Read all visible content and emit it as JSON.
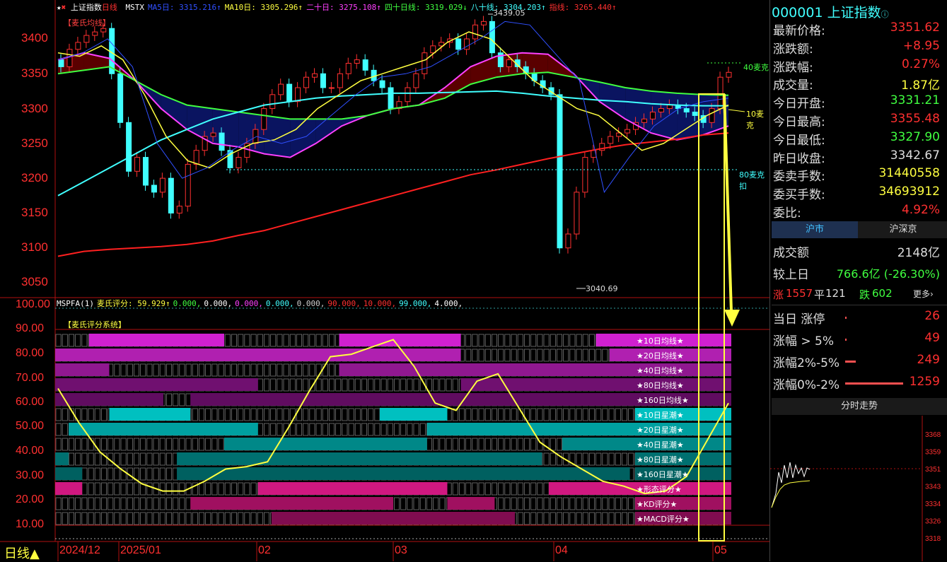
{
  "header": {
    "index_name": "上证指数",
    "period": "日线",
    "ma_items": [
      {
        "label": "MSTX",
        "color": "#ffffff"
      },
      {
        "label": "MA5日: 3315.216↑",
        "color": "#3050ff"
      },
      {
        "label": "MA10日: 3305.296↑",
        "color": "#ffff40"
      },
      {
        "label": "二十日: 3275.108↑",
        "color": "#ff40ff"
      },
      {
        "label": "四十日线: 3319.029↓",
        "color": "#40ff40"
      },
      {
        "label": "八十线: 3304.203↑",
        "color": "#40ffff"
      },
      {
        "label": "指线: 3265.440↑",
        "color": "#ff3030"
      }
    ],
    "price_high_mark": "3439.05",
    "price_low_mark": "3040.69"
  },
  "main_tag": "【麦氏均线】",
  "right_labels": {
    "ma40": "40麦克",
    "ma10": "10麦克",
    "ma80": "80麦克扣"
  },
  "sub_header": {
    "items": [
      {
        "label": "MSPFA(1)",
        "color": "#ffffff"
      },
      {
        "label": "麦氏评分: 59.929↑",
        "color": "#ffff40"
      },
      {
        "label": "0.000,",
        "color": "#40ff40"
      },
      {
        "label": "0.000,",
        "color": "#ffffff"
      },
      {
        "label": "0.000,",
        "color": "#ff40ff"
      },
      {
        "label": "0.000,",
        "color": "#40ffff"
      },
      {
        "label": "0.000,",
        "color": "#cccccc"
      },
      {
        "label": "90.000,",
        "color": "#ff3030"
      },
      {
        "label": "10.000,",
        "color": "#ff3030"
      },
      {
        "label": "99.000,",
        "color": "#40ffff"
      },
      {
        "label": "4.000,",
        "color": "#ffffff"
      }
    ],
    "system_tag": "【麦氏评分系统】"
  },
  "y_axis_main": [
    "3400",
    "3350",
    "3300",
    "3250",
    "3200",
    "3150",
    "3100",
    "3050"
  ],
  "y_axis_sub": [
    "100.00",
    "90.00",
    "80.00",
    "70.00",
    "60.00",
    "50.00",
    "40.00",
    "30.00",
    "20.00",
    "10.00"
  ],
  "x_axis": {
    "period_label": "日线▲",
    "months": [
      "2024/12",
      "2025/01",
      "02",
      "03",
      "04",
      "05"
    ]
  },
  "score_rows": [
    {
      "label": "★10日均线★",
      "color": "#d020d0"
    },
    {
      "label": "★20日均线★",
      "color": "#b020b0"
    },
    {
      "label": "★40日均线★",
      "color": "#901890"
    },
    {
      "label": "★80日均线★",
      "color": "#701070"
    },
    {
      "label": "★160日均线★",
      "color": "#600c60"
    },
    {
      "label": "★10日星潮★",
      "color": "#00c0c0"
    },
    {
      "label": "★20日星潮★",
      "color": "#00a0a0"
    },
    {
      "label": "★40日星潮★",
      "color": "#008888"
    },
    {
      "label": "★80日星潮★",
      "color": "#007070"
    },
    {
      "label": "★160日星潮★",
      "color": "#006060"
    },
    {
      "label": "★形态评分★",
      "color": "#d01880"
    },
    {
      "label": "★KD评分★",
      "color": "#a01060"
    },
    {
      "label": "★MACD评分★",
      "color": "#800c50"
    }
  ],
  "quote": {
    "code": "000001",
    "name": "上证指数",
    "rows": [
      {
        "label": "最新价格:",
        "value": "3351.62",
        "color": "#ff3030"
      },
      {
        "label": "涨跌额:",
        "value": "+8.95",
        "color": "#ff3030"
      },
      {
        "label": "涨跌幅:",
        "value": "0.27%",
        "color": "#ff3030"
      },
      {
        "label": "成交量:",
        "value": "1.87亿",
        "color": "#ffff40"
      },
      {
        "label": "今日开盘:",
        "value": "3331.21",
        "color": "#40ff40"
      },
      {
        "label": "今日最高:",
        "value": "3355.48",
        "color": "#ff3030"
      },
      {
        "label": "今日最低:",
        "value": "3327.90",
        "color": "#40ff40"
      },
      {
        "label": "昨日收盘:",
        "value": "3342.67",
        "color": "#dddddd"
      },
      {
        "label": "委卖手数:",
        "value": "31440558",
        "color": "#ffff40"
      },
      {
        "label": "委买手数:",
        "value": "34693912",
        "color": "#ffff40"
      },
      {
        "label": "委比:",
        "value": "4.92%",
        "color": "#ff3030"
      }
    ]
  },
  "market_tabs": [
    "沪市",
    "沪深京"
  ],
  "market": {
    "turnover_label": "成交额",
    "turnover_value": "2148亿",
    "compare_label": "较上日",
    "compare_value": "766.6亿 (-26.30%)",
    "up_label": "涨",
    "up_count": "1557",
    "flat_label": "平",
    "flat_count": "121",
    "down_label": "跌",
    "down_count": "602",
    "more_label": "更多",
    "stats": [
      {
        "label": "当日 涨停",
        "value": "26",
        "bar": 0.01
      },
      {
        "label": "涨幅 > 5%",
        "value": "49",
        "bar": 0.02
      },
      {
        "label": "涨幅2%-5%",
        "value": "249",
        "bar": 0.18
      },
      {
        "label": "涨幅0%-2%",
        "value": "1259",
        "bar": 1.0
      }
    ]
  },
  "intraday": {
    "title": "分时走势",
    "ticks": [
      "3368",
      "3359",
      "3351",
      "3343",
      "3334",
      "3326",
      "3318"
    ]
  },
  "chart_data": {
    "type": "line",
    "title": "上证指数 日线",
    "xlabel": "",
    "ylabel": "",
    "ylim": [
      3030,
      3450
    ],
    "series": [
      {
        "name": "MA20",
        "values": [
          3370,
          3380,
          3372,
          3340,
          3300,
          3270,
          3250,
          3245,
          3235,
          3230,
          3250,
          3275,
          3290,
          3300,
          3305,
          3330,
          3360,
          3375,
          3380,
          3378,
          3350,
          3310,
          3285,
          3265,
          3255,
          3262,
          3275
        ]
      },
      {
        "name": "MA40",
        "values": [
          3350,
          3355,
          3360,
          3340,
          3320,
          3305,
          3300,
          3295,
          3290,
          3285,
          3285,
          3285,
          3290,
          3300,
          3305,
          3315,
          3335,
          3345,
          3350,
          3352,
          3345,
          3338,
          3330,
          3325,
          3322,
          3320,
          3319
        ]
      },
      {
        "name": "MA80",
        "values": [
          3175,
          3195,
          3215,
          3235,
          3255,
          3270,
          3285,
          3295,
          3305,
          3310,
          3315,
          3318,
          3320,
          3322,
          3322,
          3323,
          3324,
          3325,
          3322,
          3318,
          3315,
          3312,
          3310,
          3307,
          3305,
          3304,
          3304
        ]
      },
      {
        "name": "MA160",
        "values": [
          3088,
          3095,
          3098,
          3100,
          3102,
          3105,
          3110,
          3118,
          3125,
          3135,
          3145,
          3155,
          3165,
          3175,
          3185,
          3195,
          3205,
          3212,
          3220,
          3228,
          3235,
          3242,
          3248,
          3252,
          3256,
          3262,
          3265
        ]
      },
      {
        "name": "麦氏评分",
        "values": [
          66,
          52,
          40,
          33,
          27,
          24,
          24,
          28,
          33,
          34,
          36,
          50,
          65,
          79,
          80,
          83,
          86,
          75,
          60,
          57,
          69,
          72,
          58,
          44,
          38,
          33,
          28,
          26,
          23,
          24,
          30,
          45,
          60
        ]
      }
    ]
  }
}
